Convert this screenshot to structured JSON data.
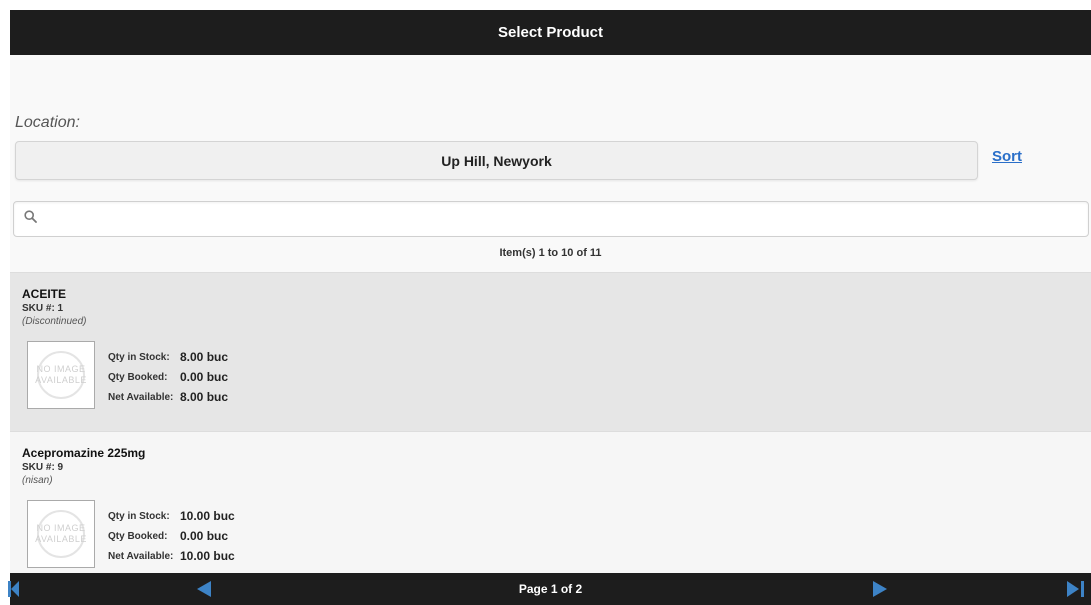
{
  "header": {
    "title": "Select Product"
  },
  "location": {
    "label": "Location:",
    "value": "Up Hill, Newyork"
  },
  "sort": {
    "label": "Sort"
  },
  "search": {
    "placeholder": "",
    "value": ""
  },
  "list": {
    "count_text": "Item(s) 1 to 10 of 11"
  },
  "qty_labels": {
    "in_stock": "Qty in Stock:",
    "booked": "Qty Booked:",
    "net": "Net Available:"
  },
  "image_placeholder": {
    "line1": "NO IMAGE",
    "line2": "AVAILABLE"
  },
  "products": [
    {
      "name": "ACEITE",
      "sku": "SKU #: 1",
      "status": "(Discontinued)",
      "qty_in_stock": "8.00 buc",
      "qty_booked": "0.00 buc",
      "net_available": "8.00 buc"
    },
    {
      "name": "Acepromazine 225mg",
      "sku": "SKU #: 9",
      "status": "(nisan)",
      "qty_in_stock": "10.00 buc",
      "qty_booked": "0.00 buc",
      "net_available": "10.00 buc"
    }
  ],
  "pagination": {
    "label": "Page 1 of 2"
  },
  "colors": {
    "bar": "#1d1d1d",
    "accent": "#3d83c6",
    "link": "#2a6fc9"
  },
  "icons": {
    "search": "search-icon",
    "first": "first-page-icon",
    "prev": "prev-page-icon",
    "next": "next-page-icon",
    "last": "last-page-icon"
  }
}
